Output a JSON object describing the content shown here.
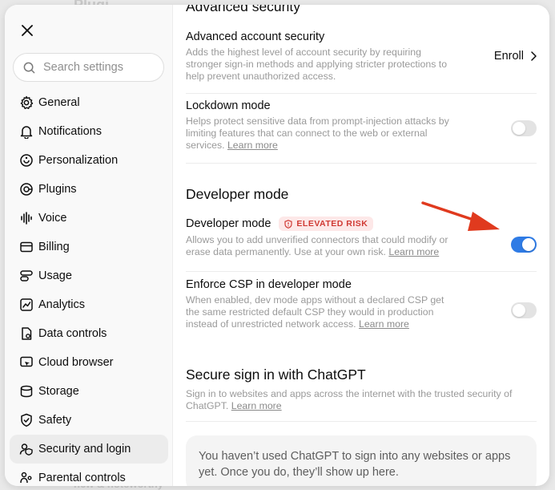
{
  "backdrop": {
    "top_text": "Plugi",
    "bottom_text": "new & noteworthy"
  },
  "sidebar": {
    "search_placeholder": "Search settings",
    "items": [
      {
        "label": "General",
        "icon": "gear-icon",
        "active": false
      },
      {
        "label": "Notifications",
        "icon": "bell-icon",
        "active": false
      },
      {
        "label": "Personalization",
        "icon": "personalization-icon",
        "active": false
      },
      {
        "label": "Plugins",
        "icon": "plugins-icon",
        "active": false
      },
      {
        "label": "Voice",
        "icon": "voice-icon",
        "active": false
      },
      {
        "label": "Billing",
        "icon": "billing-icon",
        "active": false
      },
      {
        "label": "Usage",
        "icon": "usage-icon",
        "active": false
      },
      {
        "label": "Analytics",
        "icon": "analytics-icon",
        "active": false
      },
      {
        "label": "Data controls",
        "icon": "data-controls-icon",
        "active": false
      },
      {
        "label": "Cloud browser",
        "icon": "cloud-browser-icon",
        "active": false
      },
      {
        "label": "Storage",
        "icon": "storage-icon",
        "active": false
      },
      {
        "label": "Safety",
        "icon": "shield-icon",
        "active": false
      },
      {
        "label": "Security and login",
        "icon": "security-icon",
        "active": true
      },
      {
        "label": "Parental controls",
        "icon": "parental-icon",
        "active": false
      }
    ]
  },
  "content": {
    "advanced_security_heading": "Advanced security",
    "advanced_account": {
      "title": "Advanced account security",
      "desc": "Adds the highest level of account security by requiring stronger sign-in methods and applying stricter protections to help prevent unauthorized access.",
      "action": "Enroll"
    },
    "lockdown": {
      "title": "Lockdown mode",
      "desc": "Helps protect sensitive data from prompt-injection attacks by limiting features that can connect to the web or external services.",
      "link": "Learn more",
      "enabled": false
    },
    "developer_heading": "Developer mode",
    "developer_mode": {
      "title": "Developer mode",
      "badge": "ELEVATED RISK",
      "desc": "Allows you to add unverified connectors that could modify or erase data permanently. Use at your own risk.",
      "link": "Learn more",
      "enabled": true
    },
    "enforce_csp": {
      "title": "Enforce CSP in developer mode",
      "desc": "When enabled, dev mode apps without a declared CSP get the same restricted default CSP they would in production instead of unrestricted network access.",
      "link": "Learn more",
      "enabled": false
    },
    "secure_signin_heading": "Secure sign in with ChatGPT",
    "secure_signin": {
      "desc": "Sign in to websites and apps across the internet with the trusted security of ChatGPT.",
      "link": "Learn more"
    },
    "empty_state": "You haven’t used ChatGPT to sign into any websites or apps yet. Once you do, they’ll show up here."
  },
  "colors": {
    "accent": "#2f7be5",
    "danger": "#d03a34",
    "arrow": "#e03a1e"
  }
}
